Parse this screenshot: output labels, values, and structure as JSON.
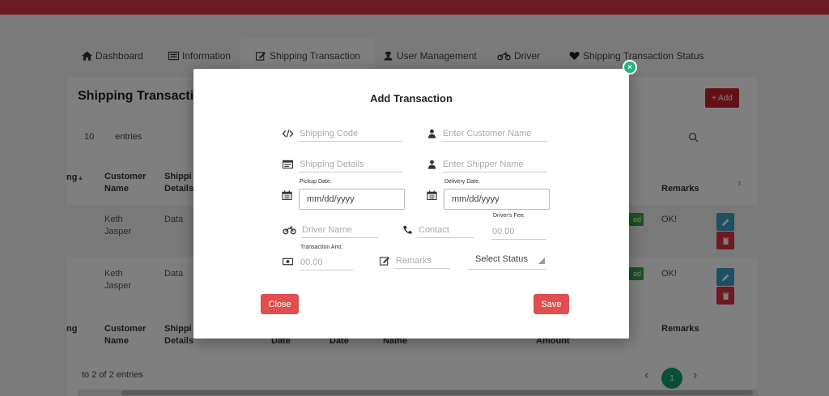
{
  "nav": {
    "tabs": [
      {
        "label": "Dashboard",
        "icon": "home-icon"
      },
      {
        "label": "Information",
        "icon": "id-card-icon"
      },
      {
        "label": "Shipping Transaction",
        "icon": "edit-icon"
      },
      {
        "label": "User Management",
        "icon": "user-secret-icon"
      },
      {
        "label": "Driver",
        "icon": "motorcycle-icon"
      },
      {
        "label": "Shipping Transaction Status",
        "icon": "heart-icon"
      }
    ]
  },
  "panel": {
    "title": "Shipping Transactions",
    "add_label": "Add",
    "entries_count": "10",
    "entries_label": "entries"
  },
  "table": {
    "headers_top": {
      "col0": "ng",
      "customer": "Customer\nName",
      "shipping": "Shippi\nDetails",
      "remarks": "Remarks"
    },
    "headers_bottom": {
      "col0": "ng",
      "customer": "Customer\nName",
      "shipping": "Shippi\nDetails",
      "pickup_date": "Date",
      "delivery_date": "Date",
      "driver_name": "Name",
      "amount": "Amount",
      "remarks": "Remarks"
    },
    "rows": [
      {
        "customer": "Keth\nJasper",
        "details": "Data",
        "status": "ed",
        "remarks": "OK!"
      },
      {
        "customer": "Keth\nJasper",
        "details": "Data",
        "status": "ed",
        "remarks": "OK!"
      }
    ],
    "footer": "to 2 of 2 entries",
    "page": "1"
  },
  "modal": {
    "title": "Add Transaction",
    "close_x": "×",
    "shipping_code_placeholder": "Shipping Code",
    "customer_name_placeholder": "Enter Customer Name",
    "shipping_details_placeholder": "Shipping Details",
    "shipper_name_placeholder": "Enter Shipper Name",
    "pickup_label": "Pickup Date.",
    "pickup_value": "mm/dd/yyyy",
    "delivery_label": "Delivery Date.",
    "delivery_value": "mm/dd/yyyy",
    "driver_name_placeholder": "Driver Name",
    "contact_placeholder": "Contact",
    "drivers_fee_label": "Driver's Fee.",
    "drivers_fee_placeholder": "00.00",
    "transaction_amt_label": "Transaction Amt.",
    "transaction_amt_placeholder": "00.00",
    "remarks_placeholder": "Remarks",
    "status_select": "Select Status",
    "close_label": "Close",
    "save_label": "Save"
  },
  "colors": {
    "accent_red": "#d9333f",
    "button_red": "#e04e4e",
    "green": "#1fb57e",
    "table_green": "#3aa348",
    "edit_blue": "#3aa0c8"
  }
}
